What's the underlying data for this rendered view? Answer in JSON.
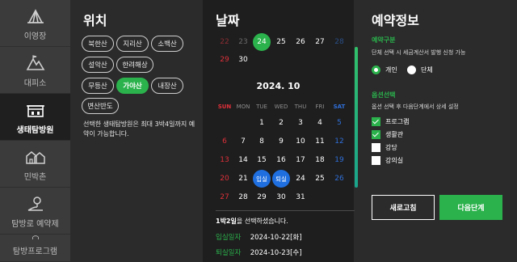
{
  "nav": {
    "items": [
      {
        "label": "이영장",
        "icon": "tent-icon"
      },
      {
        "label": "대피소",
        "icon": "mountain-hut-icon"
      },
      {
        "label": "생태탐방원",
        "icon": "lodge-icon"
      },
      {
        "label": "민박촌",
        "icon": "village-icon"
      },
      {
        "label": "탐방로 예약제",
        "icon": "trail-pin-icon"
      },
      {
        "label": "탐방프로그램",
        "icon": "headset-icon"
      }
    ],
    "active_index": 2
  },
  "location": {
    "title": "위치",
    "chips": [
      "북한산",
      "지리산",
      "소백산",
      "설악산",
      "한려해상",
      "무등산",
      "가야산",
      "내장산",
      "변산반도"
    ],
    "selected": "가야산",
    "note": "선택한 생태탐방원은 최대 3박4일까지 예약이 가능합니다."
  },
  "date": {
    "title": "날짜",
    "prev_days": [
      {
        "d": "22",
        "c": "dimred"
      },
      {
        "d": "23",
        "c": "dim"
      },
      {
        "d": "24",
        "c": "today"
      },
      {
        "d": "25",
        "c": ""
      },
      {
        "d": "26",
        "c": ""
      },
      {
        "d": "27",
        "c": ""
      },
      {
        "d": "28",
        "c": "dimblue"
      },
      {
        "d": "29",
        "c": "red"
      },
      {
        "d": "30",
        "c": ""
      }
    ],
    "month": "2024. 10",
    "weekdays": [
      "SUN",
      "MON",
      "TUE",
      "WED",
      "THU",
      "FRI",
      "SAT"
    ],
    "weeks": [
      [
        "",
        "",
        "1",
        "2",
        "3",
        "4",
        "5"
      ],
      [
        "6",
        "7",
        "8",
        "9",
        "10",
        "11",
        "12"
      ],
      [
        "13",
        "14",
        "15",
        "16",
        "17",
        "18",
        "19"
      ],
      [
        "20",
        "21",
        "입실",
        "퇴실",
        "24",
        "25",
        "26"
      ],
      [
        "27",
        "28",
        "29",
        "30",
        "31",
        "",
        ""
      ]
    ],
    "checkin_label": "입실",
    "checkout_label": "퇴실",
    "summary_stay": "1박2일",
    "summary_suffix": "을 선택하셨습니다.",
    "checkin_row_label": "입실일자",
    "checkin_date": "2024-10-22[화]",
    "checkout_row_label": "퇴실일자",
    "checkout_date": "2024-10-23[수]"
  },
  "reservation": {
    "title": "예약정보",
    "type_title": "예약구분",
    "type_desc": "단체 선택 시 세금계산서 발행 신청 가능",
    "type_options": [
      "개인",
      "단체"
    ],
    "type_selected": "개인",
    "option_title": "옵션선택",
    "option_desc": "옵션 선택 후 다음단계에서 상세 설정",
    "options": [
      {
        "label": "프로그램",
        "checked": true
      },
      {
        "label": "생활관",
        "checked": true
      },
      {
        "label": "강당",
        "checked": false
      },
      {
        "label": "강의실",
        "checked": false
      }
    ],
    "reset_label": "새로고침",
    "next_label": "다음단계"
  },
  "colors": {
    "accent": "#2bb24c",
    "sunday": "#e0303a",
    "saturday": "#2f6fd8",
    "pick": "#1f6fe0"
  }
}
